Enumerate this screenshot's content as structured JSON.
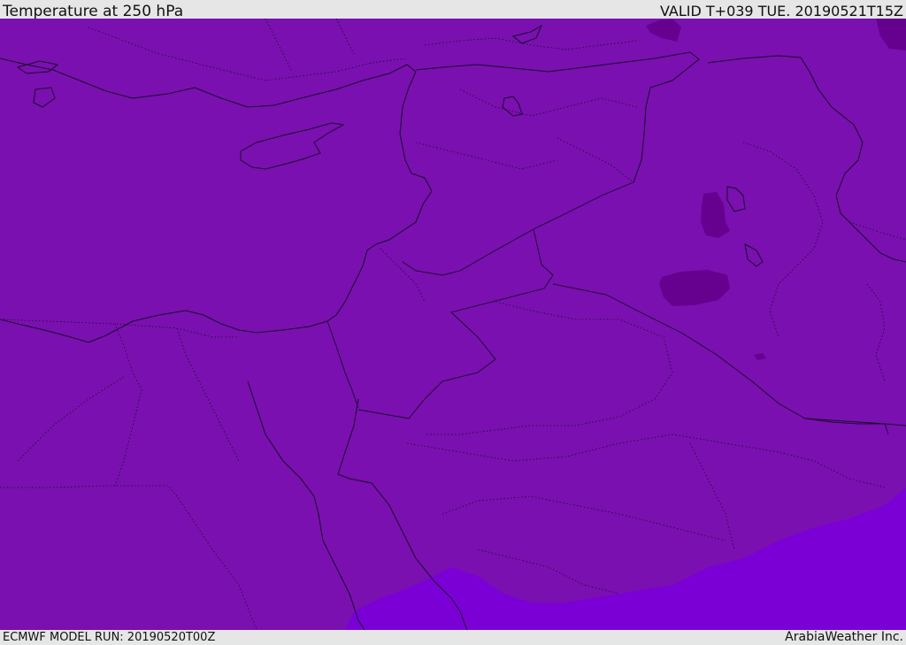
{
  "header": {
    "title": "Temperature at 250 hPa",
    "valid": "VALID T+039 TUE. 20190521T15Z"
  },
  "footer": {
    "model_run": "ECMWF MODEL RUN: 20190520T00Z",
    "brand": "ArabiaWeather Inc."
  },
  "map": {
    "field": "temperature-250hPa",
    "colors": {
      "base_fill": "#7a10b0",
      "warm_fill": "#7b00d6",
      "cold_patch": "#65008f",
      "coastline": "#1a0a2a",
      "border": "#1a0a2a"
    }
  }
}
